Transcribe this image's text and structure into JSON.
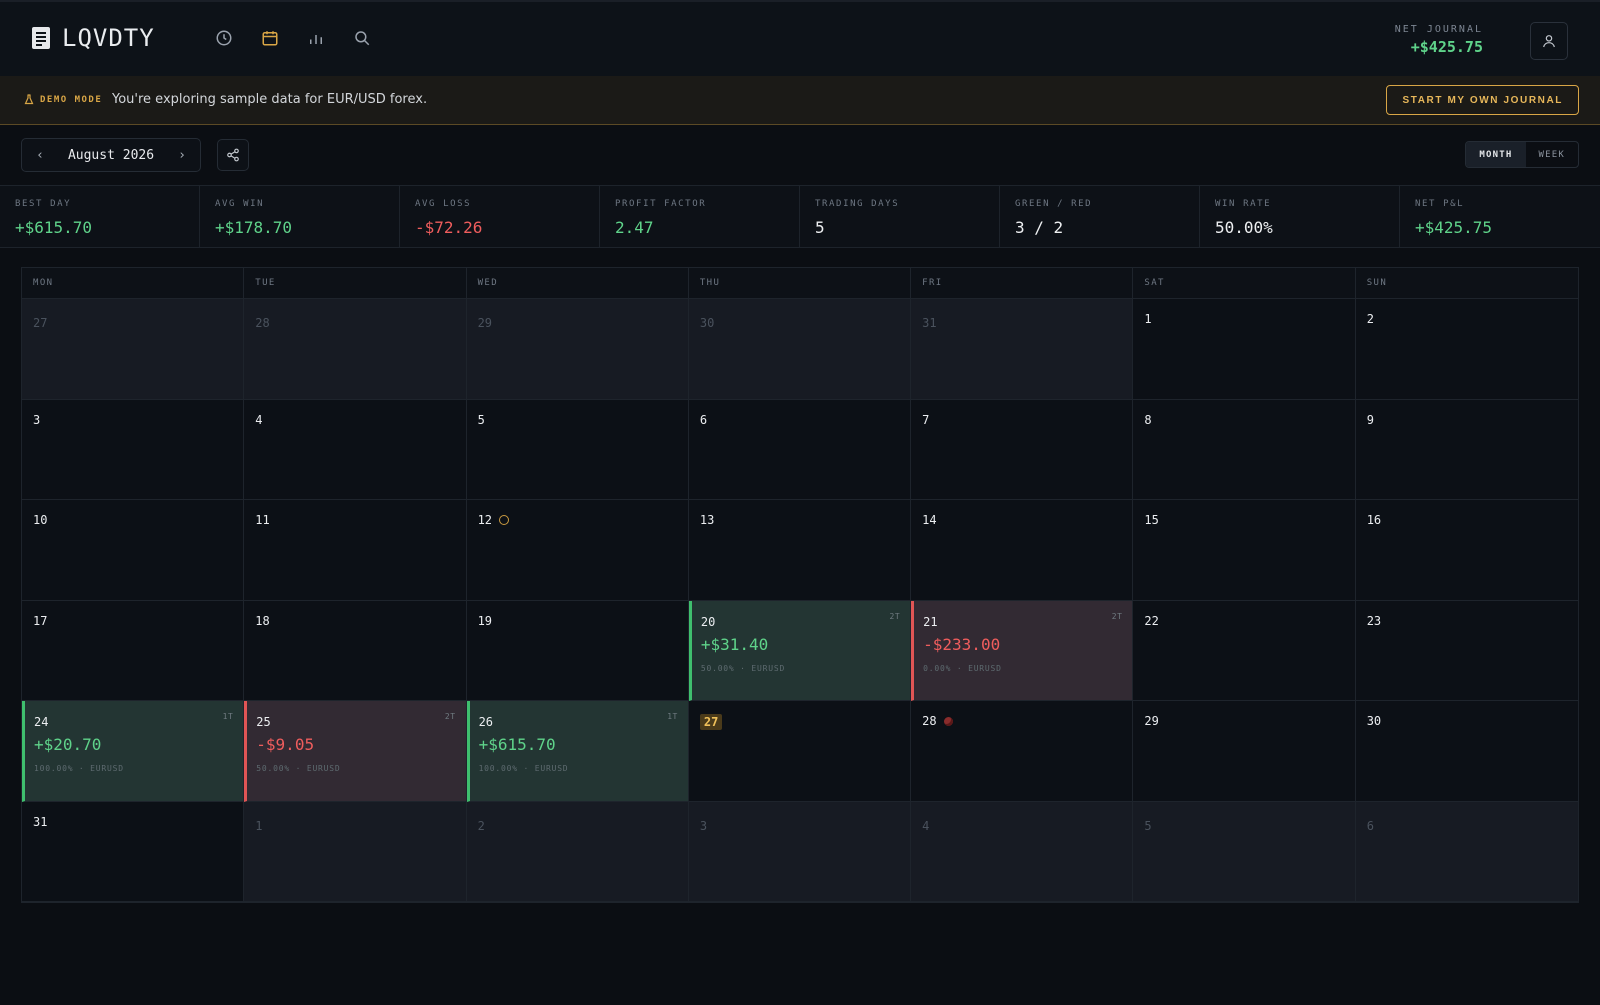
{
  "app": {
    "name": "LQVDTY"
  },
  "header": {
    "net_journal_label": "NET JOURNAL",
    "net_journal_value": "+$425.75"
  },
  "banner": {
    "tag": "DEMO MODE",
    "message": "You're exploring sample data for EUR/USD forex.",
    "cta": "START MY OWN JOURNAL"
  },
  "toolbar": {
    "month_label": "August 2026",
    "view_month": "MONTH",
    "view_week": "WEEK"
  },
  "stats": [
    {
      "label": "BEST DAY",
      "value": "+$615.70",
      "tone": "pos"
    },
    {
      "label": "AVG WIN",
      "value": "+$178.70",
      "tone": "pos"
    },
    {
      "label": "AVG LOSS",
      "value": "-$72.26",
      "tone": "neg"
    },
    {
      "label": "PROFIT FACTOR",
      "value": "2.47",
      "tone": "pos"
    },
    {
      "label": "TRADING DAYS",
      "value": "5",
      "tone": ""
    },
    {
      "label": "GREEN / RED",
      "value": "3 / 2",
      "tone": ""
    },
    {
      "label": "WIN RATE",
      "value": "50.00%",
      "tone": ""
    },
    {
      "label": "NET P&L",
      "value": "+$425.75",
      "tone": "pos"
    }
  ],
  "calendar": {
    "weekdays": [
      "MON",
      "TUE",
      "WED",
      "THU",
      "FRI",
      "SAT",
      "SUN"
    ],
    "days": [
      {
        "d": "27",
        "outside": true
      },
      {
        "d": "28",
        "outside": true
      },
      {
        "d": "29",
        "outside": true
      },
      {
        "d": "30",
        "outside": true
      },
      {
        "d": "31",
        "outside": true
      },
      {
        "d": "1"
      },
      {
        "d": "2"
      },
      {
        "d": "3"
      },
      {
        "d": "4"
      },
      {
        "d": "5"
      },
      {
        "d": "6"
      },
      {
        "d": "7"
      },
      {
        "d": "8"
      },
      {
        "d": "9"
      },
      {
        "d": "10"
      },
      {
        "d": "11"
      },
      {
        "d": "12",
        "marker": "ring"
      },
      {
        "d": "13"
      },
      {
        "d": "14"
      },
      {
        "d": "15"
      },
      {
        "d": "16"
      },
      {
        "d": "17"
      },
      {
        "d": "18"
      },
      {
        "d": "19"
      },
      {
        "d": "20",
        "result": "win",
        "count": "2T",
        "pnl": "+$31.40",
        "sub": "50.00% · EURUSD"
      },
      {
        "d": "21",
        "result": "loss",
        "count": "2T",
        "pnl": "-$233.00",
        "sub": "0.00% · EURUSD"
      },
      {
        "d": "22"
      },
      {
        "d": "23"
      },
      {
        "d": "24",
        "result": "win",
        "count": "1T",
        "pnl": "+$20.70",
        "sub": "100.00% · EURUSD"
      },
      {
        "d": "25",
        "result": "loss",
        "count": "2T",
        "pnl": "-$9.05",
        "sub": "50.00% · EURUSD"
      },
      {
        "d": "26",
        "result": "win",
        "count": "1T",
        "pnl": "+$615.70",
        "sub": "100.00% · EURUSD"
      },
      {
        "d": "27",
        "today": true
      },
      {
        "d": "28",
        "marker": "fill"
      },
      {
        "d": "29"
      },
      {
        "d": "30"
      },
      {
        "d": "31"
      },
      {
        "d": "1",
        "outside": true
      },
      {
        "d": "2",
        "outside": true
      },
      {
        "d": "3",
        "outside": true
      },
      {
        "d": "4",
        "outside": true
      },
      {
        "d": "5",
        "outside": true
      },
      {
        "d": "6",
        "outside": true
      }
    ]
  },
  "colors": {
    "accent": "#d9a646",
    "positive": "#5fd38a",
    "negative": "#ef5d5d"
  },
  "icons": [
    "document-icon",
    "clock-icon",
    "calendar-icon",
    "bar-chart-icon",
    "search-icon",
    "user-icon",
    "flask-icon",
    "share-icon",
    "chevron-left-icon",
    "chevron-right-icon"
  ]
}
